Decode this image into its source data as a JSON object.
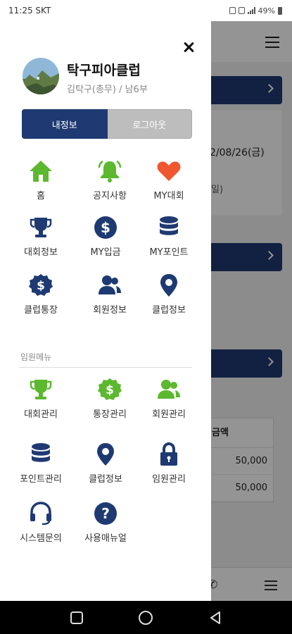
{
  "statusbar": {
    "time": "11:25",
    "carrier": "SKT",
    "battery": "49%"
  },
  "background": {
    "date_partial": "2/08/26(금)",
    "paren_partial": "일)",
    "table_header": "금액",
    "amounts": [
      "50,000",
      "50,000"
    ]
  },
  "profile": {
    "club_name": "탁구피아클럽",
    "user_info": "김탁구(총무) / 남6부"
  },
  "buttons": {
    "my_info": "내정보",
    "logout": "로그아웃"
  },
  "main_menu": [
    {
      "label": "홈",
      "icon": "home-icon"
    },
    {
      "label": "공지사항",
      "icon": "bell-icon"
    },
    {
      "label": "MY대회",
      "icon": "heart-icon"
    },
    {
      "label": "대회정보",
      "icon": "trophy-icon"
    },
    {
      "label": "MY입금",
      "icon": "dollar-coin-icon"
    },
    {
      "label": "MY포인트",
      "icon": "database-icon"
    },
    {
      "label": "클럽통장",
      "icon": "dollar-badge-icon"
    },
    {
      "label": "회원정보",
      "icon": "users-icon"
    },
    {
      "label": "클럽정보",
      "icon": "map-pin-icon"
    }
  ],
  "admin_section_label": "임원메뉴",
  "admin_menu": [
    {
      "label": "대회관리",
      "icon": "trophy-icon"
    },
    {
      "label": "통장관리",
      "icon": "dollar-badge-icon"
    },
    {
      "label": "회원관리",
      "icon": "users-icon"
    },
    {
      "label": "포인트관리",
      "icon": "database-icon"
    },
    {
      "label": "클럽정보",
      "icon": "map-pin-icon"
    },
    {
      "label": "임원관리",
      "icon": "lock-icon"
    },
    {
      "label": "시스템문의",
      "icon": "headset-icon"
    },
    {
      "label": "사용매뉴얼",
      "icon": "question-icon"
    }
  ],
  "colors": {
    "navy": "#1f3a72",
    "green": "#5cb82e",
    "red": "#f0572e",
    "gray_button": "#bdbdbd"
  }
}
